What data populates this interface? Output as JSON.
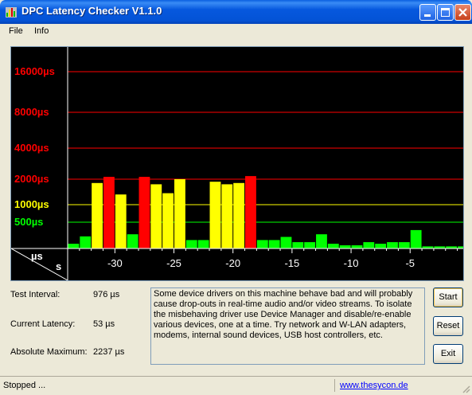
{
  "window": {
    "title": "DPC Latency Checker V1.1.0"
  },
  "menu": {
    "items": [
      "File",
      "Info"
    ]
  },
  "colors": {
    "red": "#ff0000",
    "yellow": "#ffff00",
    "green": "#00ff00",
    "title_bar": "#0453d6"
  },
  "chart_data": {
    "type": "bar",
    "xlabel": "s",
    "ylabel": "µs",
    "x_ticks": [
      "-30",
      "-25",
      "-20",
      "-15",
      "-10",
      "-5"
    ],
    "y_tick_labels": [
      {
        "text": "500µs",
        "color": "green"
      },
      {
        "text": "1000µs",
        "color": "yellow"
      },
      {
        "text": "2000µs",
        "color": "red"
      },
      {
        "text": "4000µs",
        "color": "red"
      },
      {
        "text": "8000µs",
        "color": "red"
      },
      {
        "text": "16000µs",
        "color": "red"
      }
    ],
    "y_ticks": [
      500,
      1000,
      2000,
      4000,
      8000,
      16000
    ],
    "x_range": [
      -34,
      -0.5
    ],
    "grid": true,
    "x": [
      -33.5,
      -32.5,
      -31.5,
      -30.5,
      -29.5,
      -28.5,
      -27.5,
      -26.5,
      -25.5,
      -24.5,
      -23.5,
      -22.5,
      -21.5,
      -20.5,
      -19.5,
      -18.5,
      -17.5,
      -16.5,
      -15.5,
      -14.5,
      -13.5,
      -12.5,
      -11.5,
      -10.5,
      -9.5,
      -8.5,
      -7.5,
      -6.5,
      -5.5,
      -4.5,
      -3.5,
      -2.5,
      -1.5,
      -0.5
    ],
    "values": [
      90,
      230,
      1850,
      2150,
      1400,
      270,
      2150,
      1800,
      1450,
      2000,
      160,
      160,
      1900,
      1800,
      1850,
      2200,
      160,
      160,
      220,
      120,
      120,
      270,
      90,
      60,
      60,
      120,
      90,
      120,
      120,
      350,
      40,
      40,
      40,
      40
    ],
    "bar_colors": [
      "green",
      "green",
      "yellow",
      "red",
      "yellow",
      "green",
      "red",
      "yellow",
      "yellow",
      "yellow",
      "green",
      "green",
      "yellow",
      "yellow",
      "yellow",
      "red",
      "green",
      "green",
      "green",
      "green",
      "green",
      "green",
      "green",
      "green",
      "green",
      "green",
      "green",
      "green",
      "green",
      "green",
      "green",
      "green",
      "green",
      "green"
    ]
  },
  "info": {
    "test_interval_label": "Test Interval:",
    "test_interval_value": "976 µs",
    "current_latency_label": "Current Latency:",
    "current_latency_value": "53 µs",
    "absolute_maximum_label": "Absolute Maximum:",
    "absolute_maximum_value": "2237 µs"
  },
  "message": "Some device drivers on this machine behave bad and will probably cause drop-outs in real-time audio and/or video streams. To isolate the misbehaving driver use Device Manager and disable/re-enable various devices, one at a time. Try network and W-LAN adapters, modems, internal sound devices, USB host controllers, etc.",
  "buttons": {
    "start": "Start",
    "reset": "Reset",
    "exit": "Exit"
  },
  "status": {
    "text": "Stopped ...",
    "link": "www.thesycon.de"
  }
}
